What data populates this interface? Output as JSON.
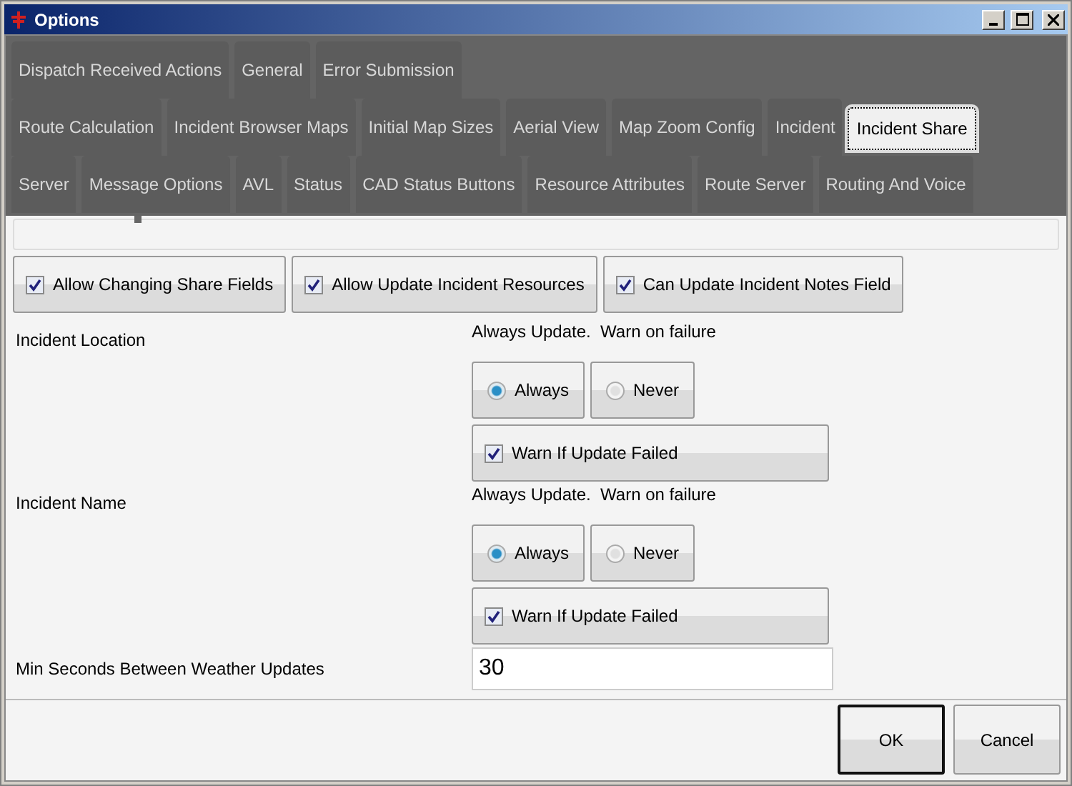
{
  "window": {
    "title": "Options"
  },
  "tab_rows": [
    [
      {
        "label": "Dispatch Received Actions",
        "selected": false
      },
      {
        "label": "General",
        "selected": false
      },
      {
        "label": "Error Submission",
        "selected": false
      }
    ],
    [
      {
        "label": "Route Calculation",
        "selected": false
      },
      {
        "label": "Incident Browser Maps",
        "selected": false
      },
      {
        "label": "Initial Map Sizes",
        "selected": false
      },
      {
        "label": "Aerial View",
        "selected": false
      },
      {
        "label": "Map Zoom Config",
        "selected": false
      },
      {
        "label": "Incident",
        "selected": false
      },
      {
        "label": "Incident Share",
        "selected": true
      }
    ],
    [
      {
        "label": "Server",
        "selected": false
      },
      {
        "label": "Message Options",
        "selected": false
      },
      {
        "label": "AVL",
        "selected": false
      },
      {
        "label": "Status",
        "selected": false
      },
      {
        "label": "CAD Status Buttons",
        "selected": false
      },
      {
        "label": "Resource Attributes",
        "selected": false
      },
      {
        "label": "Route Server",
        "selected": false
      },
      {
        "label": "Routing And Voice",
        "selected": false
      }
    ]
  ],
  "checkbox_buttons": [
    {
      "label": "Allow Changing Share Fields",
      "checked": true
    },
    {
      "label": "Allow Update Incident Resources",
      "checked": true
    },
    {
      "label": "Can Update Incident Notes Field",
      "checked": true
    }
  ],
  "settings": [
    {
      "label": "Incident Location",
      "hint": "Always Update.  Warn on failure",
      "options": [
        {
          "label": "Always",
          "selected": true
        },
        {
          "label": "Never",
          "selected": false
        }
      ],
      "warn": {
        "label": "Warn If Update Failed",
        "checked": true
      }
    },
    {
      "label": "Incident Name",
      "hint": "Always Update.  Warn on failure",
      "options": [
        {
          "label": "Always",
          "selected": true
        },
        {
          "label": "Never",
          "selected": false
        }
      ],
      "warn": {
        "label": "Warn If Update Failed",
        "checked": true
      }
    }
  ],
  "min_seconds": {
    "label": "Min Seconds Between Weather Updates",
    "value": "30"
  },
  "buttons": [
    {
      "label": "OK",
      "default": true
    },
    {
      "label": "Cancel",
      "default": false
    }
  ]
}
